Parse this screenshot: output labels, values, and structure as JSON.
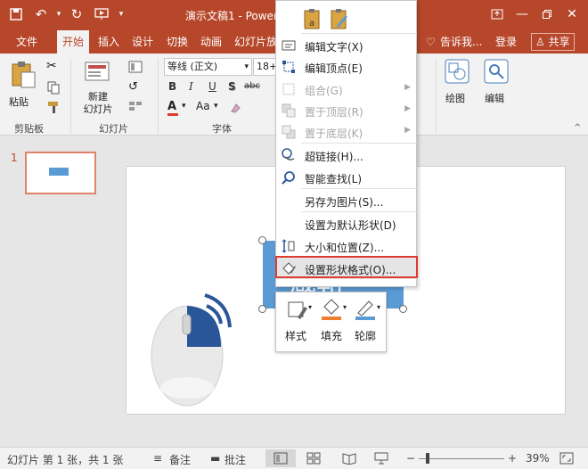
{
  "window": {
    "title": "演示文稿1 - Power"
  },
  "tabs": [
    "文件",
    "开始",
    "插入",
    "设计",
    "切换",
    "动画",
    "幻灯片放"
  ],
  "tabs_right": {
    "tell_me": "告诉我...",
    "login": "登录",
    "share": "共享"
  },
  "ribbon": {
    "paste": "粘贴",
    "new_slide": "新建\n幻灯片",
    "font_name": "等线 (正文)",
    "font_size": "18+",
    "bold": "B",
    "italic": "I",
    "underline": "U",
    "shadow": "S",
    "strike": "abc",
    "drawing": "绘图",
    "editing": "编辑",
    "groups": {
      "clipboard": "剪贴板",
      "slides": "幻灯片",
      "font": "字体"
    }
  },
  "thumbnail": {
    "number": "1"
  },
  "slide": {
    "shape_text": "感知"
  },
  "minibar": {
    "style": "样式",
    "fill": "填充",
    "outline": "轮廓"
  },
  "context_menu": [
    {
      "label": "编辑文字(X)",
      "enabled": true,
      "submenu": false
    },
    {
      "label": "编辑顶点(E)",
      "enabled": true,
      "submenu": false
    },
    {
      "label": "组合(G)",
      "enabled": false,
      "submenu": true
    },
    {
      "label": "置于顶层(R)",
      "enabled": false,
      "submenu": true
    },
    {
      "label": "置于底层(K)",
      "enabled": false,
      "submenu": true
    },
    {
      "label": "超链接(H)...",
      "enabled": true,
      "submenu": false
    },
    {
      "label": "智能查找(L)",
      "enabled": true,
      "submenu": false
    },
    {
      "label": "另存为图片(S)...",
      "enabled": true,
      "submenu": false
    },
    {
      "label": "设置为默认形状(D)",
      "enabled": true,
      "submenu": false
    },
    {
      "label": "大小和位置(Z)...",
      "enabled": true,
      "submenu": false
    },
    {
      "label": "设置形状格式(O)...",
      "enabled": true,
      "submenu": false
    }
  ],
  "status": {
    "slide_info": "幻灯片 第 1 张，共 1 张",
    "notes": "备注",
    "comments": "批注",
    "zoom": "39%"
  },
  "colors": {
    "accent": "#b7472a",
    "shape": "#5b9bd5",
    "highlight": "#e03c31"
  }
}
